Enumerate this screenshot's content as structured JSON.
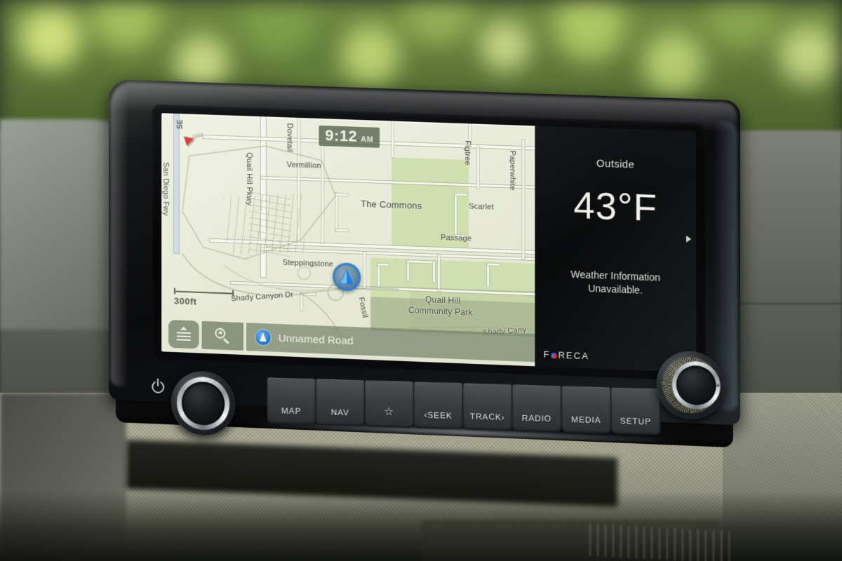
{
  "screen": {
    "clock": {
      "time": "9:12",
      "period": "AM"
    },
    "compass": {
      "direction": "SE"
    },
    "scale": {
      "label": "300ft"
    },
    "current_road": "Unnamed Road",
    "toolbar": {
      "menu_icon": "menu-icon",
      "search_icon": "search-icon",
      "road_icon": "navigation-arrow-icon"
    },
    "map_labels": {
      "highway_left": "San Diego Fwy",
      "quail_hill_pkwy": "Quail Hill Pkwy",
      "vermillion": "Vermillion",
      "the_commons": "The Commons",
      "scarlet": "Scarlet",
      "passage": "Passage",
      "figtree": "Figtree",
      "paperwhite": "Paperwhite",
      "dovetail": "Dovetail",
      "steppingstone": "Steppingstone",
      "shady_canyon_dr": "Shady Canyon Dr",
      "shady_canyon_short": "Shady Cany",
      "fossil": "Fossil",
      "quail_hill_park_line1": "Quail Hill",
      "quail_hill_park_line2": "Community Park"
    },
    "weather": {
      "title": "Outside",
      "temperature": "43°F",
      "message_line1": "Weather Information",
      "message_line2": "Unavailable.",
      "brand_prefix": "F",
      "brand_suffix": "RECA",
      "next_chevron": "chevron-right-icon"
    }
  },
  "hardware": {
    "buttons": [
      {
        "label": "MAP",
        "name": "map-button"
      },
      {
        "label": "NAV",
        "name": "nav-button"
      },
      {
        "label": "☆",
        "name": "favorites-button"
      },
      {
        "label": "‹SEEK",
        "name": "seek-button"
      },
      {
        "label": "TRACK›",
        "name": "track-button"
      },
      {
        "label": "RADIO",
        "name": "radio-button"
      },
      {
        "label": "MEDIA",
        "name": "media-button"
      },
      {
        "label": "SETUP",
        "name": "setup-button"
      }
    ],
    "power_knob": "power-volume-knob",
    "tune_knob": "tune-scroll-knob",
    "power_icon": "power-icon"
  },
  "colors": {
    "map_background": "#e9ebd9",
    "park_green": "#cfdeae",
    "road_white": "#f6f7ee",
    "highway_blue": "#cfd9e6",
    "ui_green": "#74826 8",
    "accent_blue": "#2f7fd0",
    "compass_red": "#d2342a",
    "panel_black": "#0b0c0d",
    "text_light": "#f0f2ea"
  }
}
